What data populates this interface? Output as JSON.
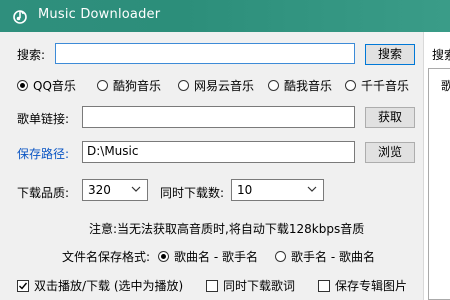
{
  "window": {
    "title": "Music Downloader",
    "icon": "music-note-icon"
  },
  "search": {
    "label": "搜索:",
    "value": "",
    "button": "搜索"
  },
  "sources": [
    {
      "label": "QQ音乐",
      "selected": true
    },
    {
      "label": "酷狗音乐",
      "selected": false
    },
    {
      "label": "网易云音乐",
      "selected": false
    },
    {
      "label": "酷我音乐",
      "selected": false
    },
    {
      "label": "千千音乐",
      "selected": false
    }
  ],
  "playlist": {
    "label": "歌单链接:",
    "value": "",
    "button": "获取"
  },
  "save_path": {
    "label": "保存路径:",
    "value": "D:\\Music",
    "button": "浏览",
    "label_color": "#0b56c4"
  },
  "quality": {
    "label": "下载品质:",
    "value": "320"
  },
  "concurrent": {
    "label": "同时下载数:",
    "value": "10"
  },
  "note": "注意:当无法获取高音质时,将自动下载128kbps音质",
  "filename_format": {
    "label": "文件名保存格式:",
    "options": [
      {
        "label": "歌曲名 - 歌手名",
        "selected": true
      },
      {
        "label": "歌手名 - 歌曲名",
        "selected": false
      }
    ]
  },
  "checkboxes": [
    {
      "label": "双击播放/下载 (选中为播放)",
      "checked": true
    },
    {
      "label": "同时下载歌词",
      "checked": false
    },
    {
      "label": "保存专辑图片",
      "checked": false
    }
  ],
  "side_panel": {
    "tab": "搜索",
    "list_header": "歌"
  },
  "colors": {
    "titlebar": "#2f8f7d",
    "focus_border": "#3d8bd7",
    "accent": "#0b56c4"
  }
}
